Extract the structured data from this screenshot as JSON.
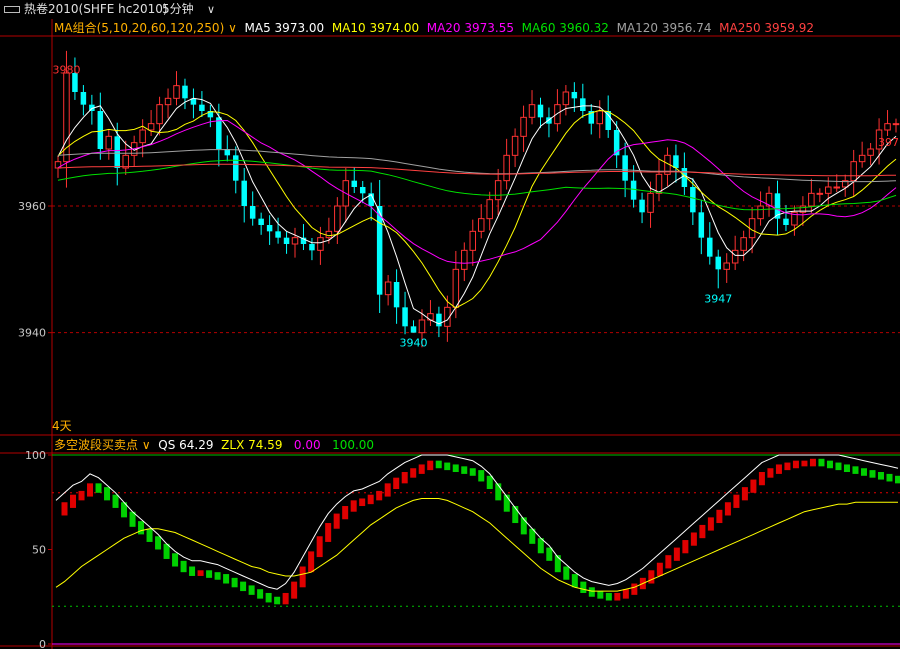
{
  "header": {
    "title": "热卷2010(SHFE hc2010)",
    "period": "5分钟",
    "period_dropdown_icon": "chevron-down-icon",
    "window_icon": "window-icon"
  },
  "colors": {
    "up": "#ff3232",
    "down": "#00ffff",
    "ma5": "#ffffff",
    "ma10": "#ffff00",
    "ma20": "#ff00ff",
    "ma60": "#00e000",
    "ma120": "#a0a0a0",
    "ma250": "#ff4040",
    "grid": "#b40000",
    "indicator_up": "#e00000",
    "indicator_down": "#00d000",
    "qs": "#ffffff",
    "zlx": "#ffff00"
  },
  "main_legend": {
    "group": "MA组合(5,10,20,60,120,250)",
    "items": [
      {
        "key": "ma5",
        "label": "MA5 3973.00"
      },
      {
        "key": "ma10",
        "label": "MA10 3974.00"
      },
      {
        "key": "ma20",
        "label": "MA20 3973.55"
      },
      {
        "key": "ma60",
        "label": "MA60 3960.32"
      },
      {
        "key": "ma120",
        "label": "MA120 3956.74"
      },
      {
        "key": "ma250",
        "label": "MA250 3959.92"
      }
    ]
  },
  "main_axis": {
    "ticks": [
      "3960",
      "3940"
    ],
    "tick_values": [
      3960,
      3940
    ],
    "ylim": [
      3924,
      3987
    ]
  },
  "period_label": "4天",
  "annotations": {
    "high": "3980",
    "low_left": "3940",
    "low_right": "3947",
    "right_cut": "397"
  },
  "indicator_legend": {
    "name": "多空波段买卖点",
    "items": [
      {
        "key": "qs",
        "label": "QS 64.29"
      },
      {
        "key": "zlx",
        "label": "ZLX 74.59"
      },
      {
        "key": "c1",
        "label": "0.00"
      },
      {
        "key": "c2",
        "label": "100.00"
      }
    ]
  },
  "indicator_axis": {
    "ticks": [
      "100",
      "50",
      "0"
    ],
    "tick_values": [
      100,
      50,
      0
    ],
    "ylim": [
      0,
      100
    ]
  },
  "chart_data": [
    {
      "type": "candlestick",
      "title": "热卷2010(SHFE hc2010) 5分钟",
      "ylim": [
        3924,
        3987
      ],
      "ma_periods": [
        5,
        10,
        20,
        60,
        120,
        250
      ],
      "closes": [
        3967,
        3981,
        3978,
        3976,
        3975,
        3969,
        3971,
        3966,
        3968,
        3970,
        3972,
        3973,
        3976,
        3977,
        3979,
        3977,
        3976,
        3975,
        3974,
        3969,
        3968,
        3964,
        3960,
        3958,
        3957,
        3956,
        3955,
        3954,
        3955,
        3954,
        3953,
        3955,
        3956,
        3960,
        3964,
        3963,
        3962,
        3960,
        3946,
        3948,
        3944,
        3941,
        3940,
        3942,
        3943,
        3941,
        3944,
        3950,
        3953,
        3956,
        3958,
        3961,
        3964,
        3968,
        3971,
        3974,
        3976,
        3974,
        3973,
        3976,
        3978,
        3977,
        3975,
        3973,
        3975,
        3972,
        3968,
        3964,
        3961,
        3959,
        3962,
        3965,
        3968,
        3966,
        3963,
        3959,
        3955,
        3952,
        3950,
        3951,
        3953,
        3955,
        3958,
        3960,
        3962,
        3958,
        3957,
        3959,
        3960,
        3962,
        3962,
        3963,
        3963,
        3964,
        3967,
        3968,
        3969,
        3972,
        3973,
        3973
      ],
      "high_label": "3980",
      "low_labels": [
        "3940",
        "3947"
      ]
    },
    {
      "type": "line+bar",
      "title": "多空波段买卖点",
      "ylim": [
        0,
        100
      ],
      "qs": [
        72,
        76,
        80,
        82,
        86,
        84,
        80,
        76,
        71,
        66,
        62,
        58,
        54,
        49,
        45,
        42,
        40,
        40,
        39,
        38,
        36,
        34,
        32,
        30,
        28,
        26,
        25,
        28,
        34,
        42,
        50,
        58,
        65,
        70,
        74,
        77,
        78,
        80,
        82,
        86,
        89,
        92,
        94,
        96,
        98,
        97,
        96,
        95,
        94,
        93,
        90,
        86,
        80,
        74,
        68,
        62,
        57,
        52,
        48,
        42,
        38,
        34,
        31,
        29,
        28,
        27,
        28,
        30,
        33,
        36,
        40,
        44,
        48,
        52,
        56,
        60,
        64,
        68,
        72,
        76,
        80,
        84,
        88,
        92,
        94,
        96,
        97,
        98,
        98,
        99,
        98,
        97,
        96,
        95,
        94,
        93,
        92,
        91,
        90,
        89
      ],
      "zlx": [
        30,
        33,
        37,
        41,
        44,
        47,
        50,
        53,
        56,
        58,
        60,
        61,
        61,
        60,
        59,
        57,
        55,
        53,
        51,
        49,
        47,
        45,
        43,
        41,
        40,
        38,
        37,
        36,
        36,
        37,
        38,
        41,
        44,
        47,
        51,
        55,
        59,
        63,
        66,
        69,
        72,
        74,
        76,
        77,
        77,
        77,
        76,
        74,
        72,
        70,
        67,
        64,
        60,
        56,
        52,
        48,
        44,
        40,
        37,
        34,
        32,
        30,
        29,
        28,
        28,
        28,
        28,
        29,
        30,
        32,
        34,
        36,
        38,
        40,
        42,
        44,
        46,
        48,
        50,
        52,
        54,
        56,
        58,
        60,
        62,
        64,
        66,
        68,
        70,
        71,
        72,
        73,
        74,
        74,
        75,
        75,
        75,
        75,
        75,
        75
      ],
      "levels": [
        20,
        50,
        80,
        100
      ],
      "last": {
        "QS": 64.29,
        "ZLX": 74.59
      }
    }
  ]
}
